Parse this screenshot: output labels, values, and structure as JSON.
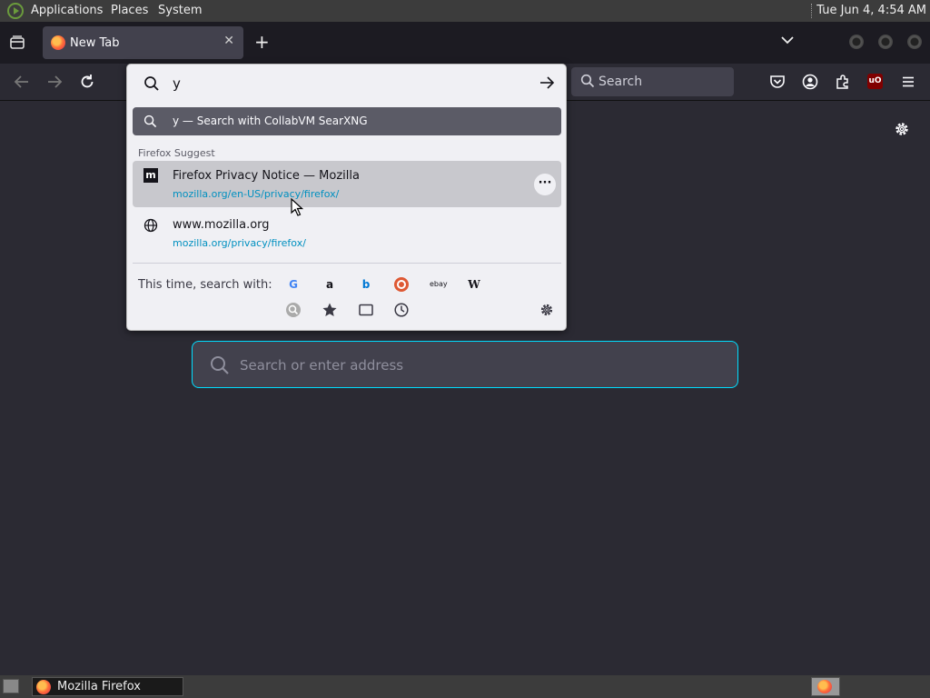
{
  "top_panel": {
    "menus": [
      "Applications",
      "Places",
      "System"
    ],
    "clock": "Tue Jun  4,  4:54 AM"
  },
  "tabs": [
    {
      "title": "New Tab",
      "close_label": "✕"
    }
  ],
  "tab_strip": {
    "new_tab_label": "+",
    "overflow_label": "⌄"
  },
  "nav": {
    "search_label": "Search"
  },
  "urlbar": {
    "value": "y",
    "search_with": "y — Search with CollabVM SearXNG",
    "suggest_heading": "Firefox Suggest",
    "results": [
      {
        "title": "Firefox Privacy Notice — Mozilla",
        "url": "mozilla.org/en-US/privacy/firefox/",
        "icon": "mozilla-m-icon"
      },
      {
        "title": "www.mozilla.org",
        "url": "mozilla.org/privacy/firefox/",
        "icon": "globe-icon"
      }
    ],
    "oneoff_label": "This time, search with:",
    "engines": [
      "Google",
      "Amazon",
      "Bing",
      "DuckDuckGo",
      "eBay",
      "Wikipedia",
      "SearXNG"
    ],
    "engine_glyphs": {
      "google": "G",
      "amazon": "a",
      "bing": "b",
      "ebay": "ebay",
      "wikipedia": "W"
    }
  },
  "newtab": {
    "search_placeholder": "Search or enter address"
  },
  "taskbar": {
    "window_label": "Mozilla Firefox"
  },
  "colors": {
    "accent": "#00ddff",
    "url": "#0090c0",
    "selected_row": "#c8c8cd",
    "firefox_orange": "#ff7139"
  }
}
